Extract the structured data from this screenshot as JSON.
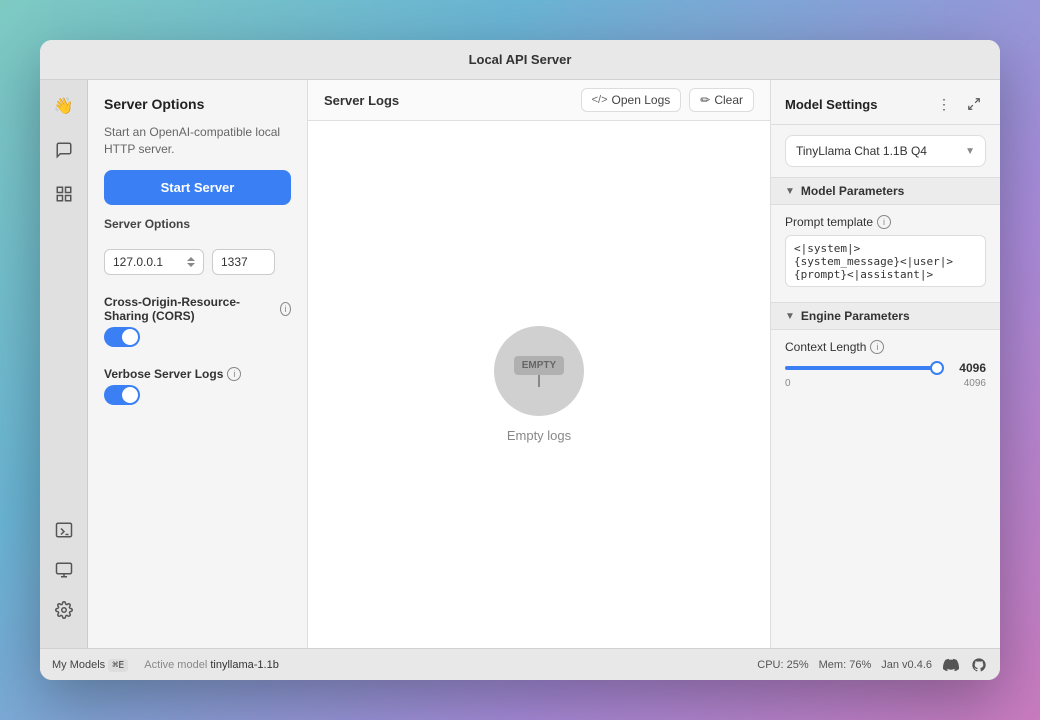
{
  "window": {
    "title": "Local API Server"
  },
  "sidebar": {
    "icons": [
      {
        "name": "hand-wave-icon",
        "symbol": "👋"
      },
      {
        "name": "chat-icon",
        "symbol": "💬"
      },
      {
        "name": "grid-icon",
        "symbol": "⊞"
      }
    ],
    "bottom_icons": [
      {
        "name": "terminal-icon",
        "symbol": "⬛"
      },
      {
        "name": "monitor-icon",
        "symbol": "🖥"
      },
      {
        "name": "settings-icon",
        "symbol": "⚙"
      }
    ]
  },
  "left_panel": {
    "title": "Server Options",
    "subtitle": "Start an OpenAI-compatible local HTTP server.",
    "start_button_label": "Start Server",
    "server_options_label": "Server Options",
    "host_value": "127.0.0.1",
    "port_value": "1337",
    "cors_label": "Cross-Origin-Resource-Sharing (CORS)",
    "cors_enabled": true,
    "verbose_label": "Verbose Server Logs",
    "verbose_enabled": true
  },
  "server_logs": {
    "title": "Server Logs",
    "open_logs_label": "Open Logs",
    "clear_label": "Clear",
    "empty_text": "Empty logs",
    "empty_sign_text": "EMPTY"
  },
  "right_panel": {
    "title": "Model Settings",
    "model_selector": {
      "selected": "TinyLlama Chat 1.1B Q4"
    },
    "model_parameters": {
      "section_title": "Model Parameters",
      "prompt_template_label": "Prompt template",
      "prompt_template_value": "<|system|>\n{system_message}<|user|>\n{prompt}<|assistant|>"
    },
    "engine_parameters": {
      "section_title": "Engine Parameters",
      "context_length_label": "Context Length",
      "context_length_value": 4096,
      "context_length_min": 0,
      "context_length_max": 4096,
      "context_length_fill_pct": 95
    }
  },
  "status_bar": {
    "my_models_label": "My Models",
    "my_models_shortcut": "⌘E",
    "active_model_label": "Active model",
    "active_model_name": "tinyllama-1.1b",
    "cpu_label": "CPU:",
    "cpu_value": "25%",
    "mem_label": "Mem:",
    "mem_value": "76%",
    "version": "Jan v0.4.6"
  }
}
